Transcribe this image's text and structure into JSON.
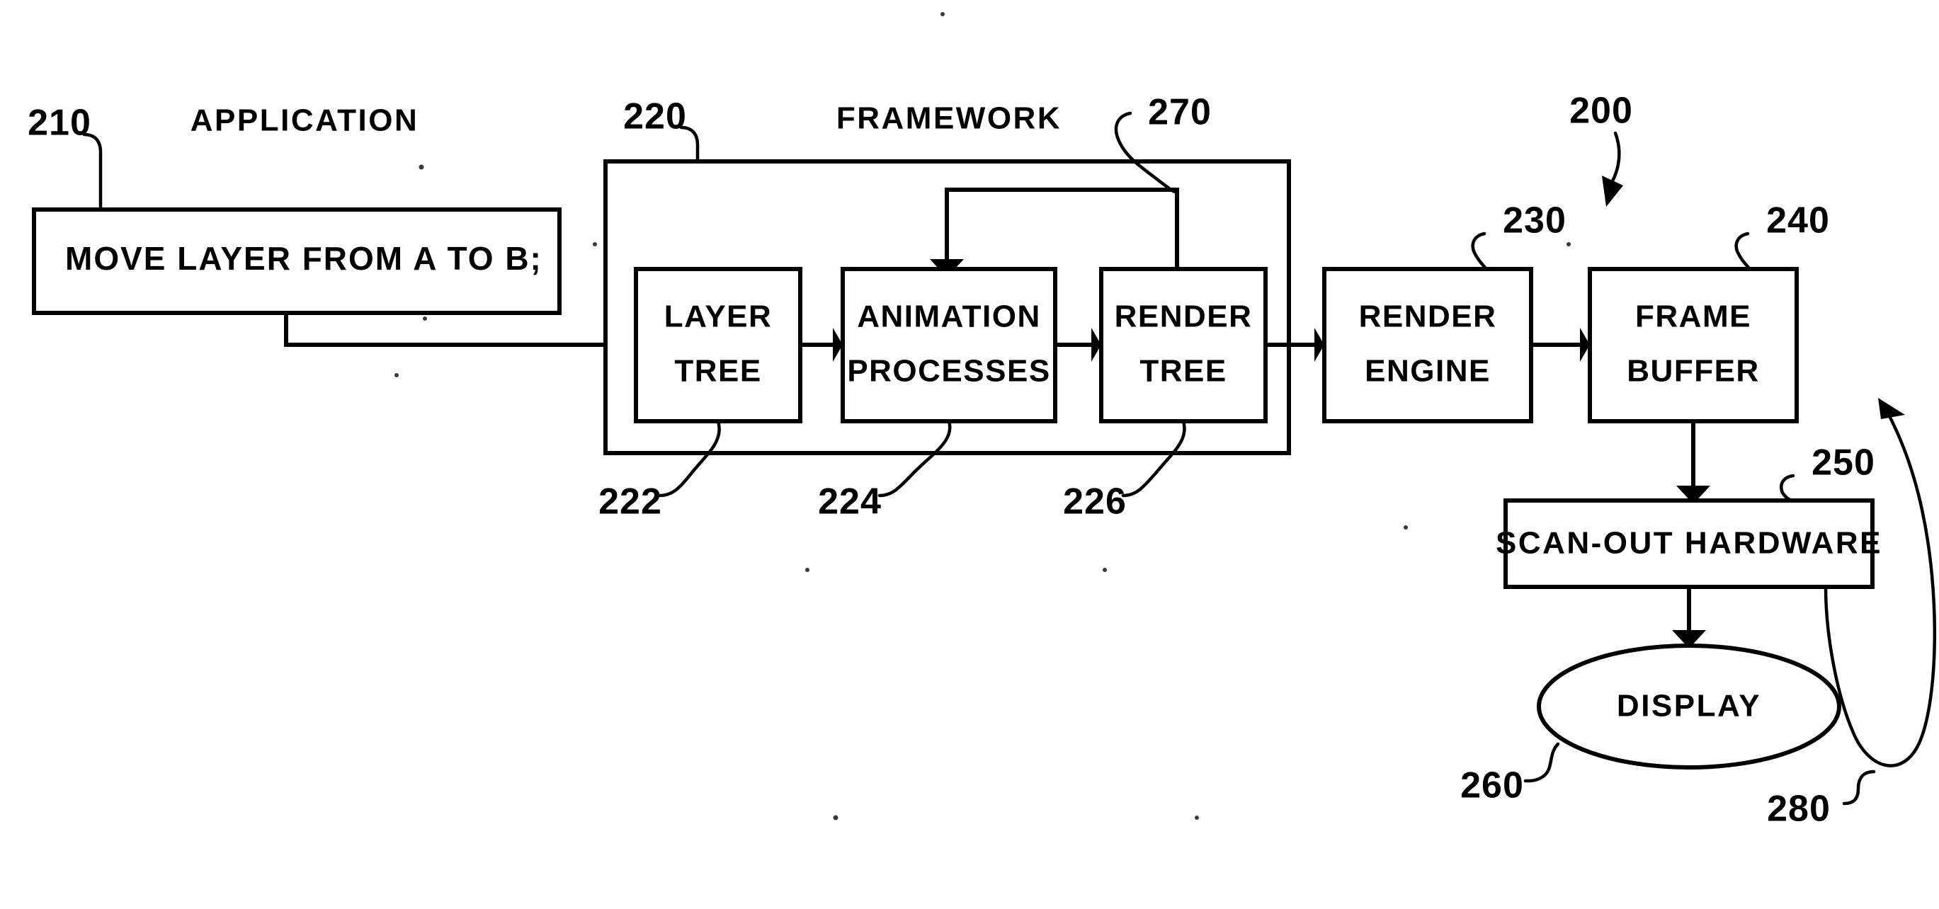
{
  "figure": {
    "reference_numeral": "200",
    "application": {
      "title": "APPLICATION",
      "ref": "210",
      "code_text": "MOVE LAYER FROM A TO B;"
    },
    "framework": {
      "title": "FRAMEWORK",
      "ref": "220",
      "feedback_ref": "270",
      "stages": [
        {
          "label_line1": "LAYER",
          "label_line2": "TREE",
          "ref": "222"
        },
        {
          "label_line1": "ANIMATION",
          "label_line2": "PROCESSES",
          "ref": "224"
        },
        {
          "label_line1": "RENDER",
          "label_line2": "TREE",
          "ref": "226"
        }
      ]
    },
    "pipeline": [
      {
        "label_line1": "RENDER",
        "label_line2": "ENGINE",
        "ref": "230"
      },
      {
        "label_line1": "FRAME",
        "label_line2": "BUFFER",
        "ref": "240"
      }
    ],
    "scan_out": {
      "label": "SCAN-OUT HARDWARE",
      "ref": "250"
    },
    "display": {
      "label": "DISPLAY",
      "ref": "260"
    },
    "vsync_feedback": {
      "ref": "280"
    },
    "colors": {
      "ink": "#000000",
      "paper": "#ffffff"
    }
  }
}
